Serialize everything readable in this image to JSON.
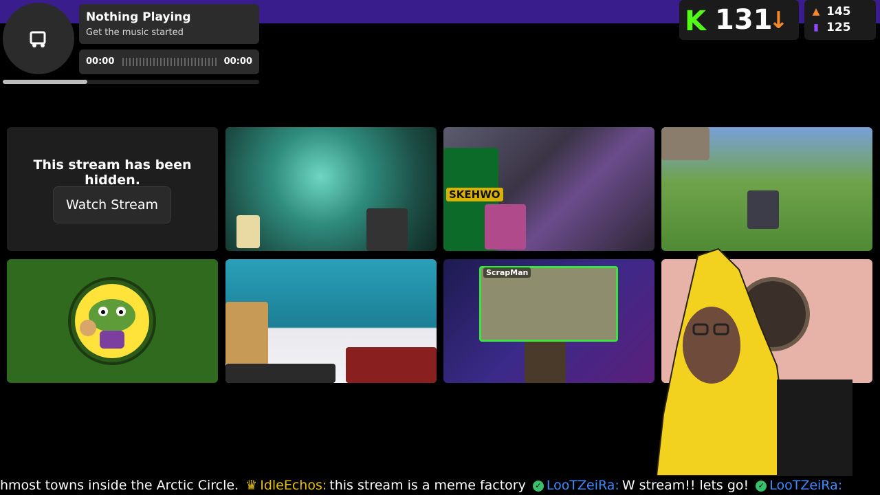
{
  "music": {
    "title": "Nothing Playing",
    "subtitle": "Get the music started",
    "time_start": "00:00",
    "time_end": "00:00",
    "progress": 0.33
  },
  "kick": {
    "logo": "K",
    "viewers": "131",
    "trend_icon": "arrow-down-icon"
  },
  "stats": {
    "followers": "145",
    "subs": "125"
  },
  "tiles": {
    "hidden_text": "This stream has been hidden.",
    "watch_label": "Watch Stream",
    "labels": [
      "SKEHWO",
      "ScrapMan"
    ]
  },
  "ticker": {
    "lead": "hmost towns inside the Arctic Circle.",
    "user1": "IdleEchos:",
    "msg1": "this stream is a meme factory",
    "user2": "LooTZeiRa:",
    "msg2": "W stream!! lets go!",
    "user3": "LooTZeiRa:"
  },
  "colors": {
    "kick_green": "#53fc18",
    "accent_orange": "#f3872b",
    "purple": "#9146ff"
  }
}
